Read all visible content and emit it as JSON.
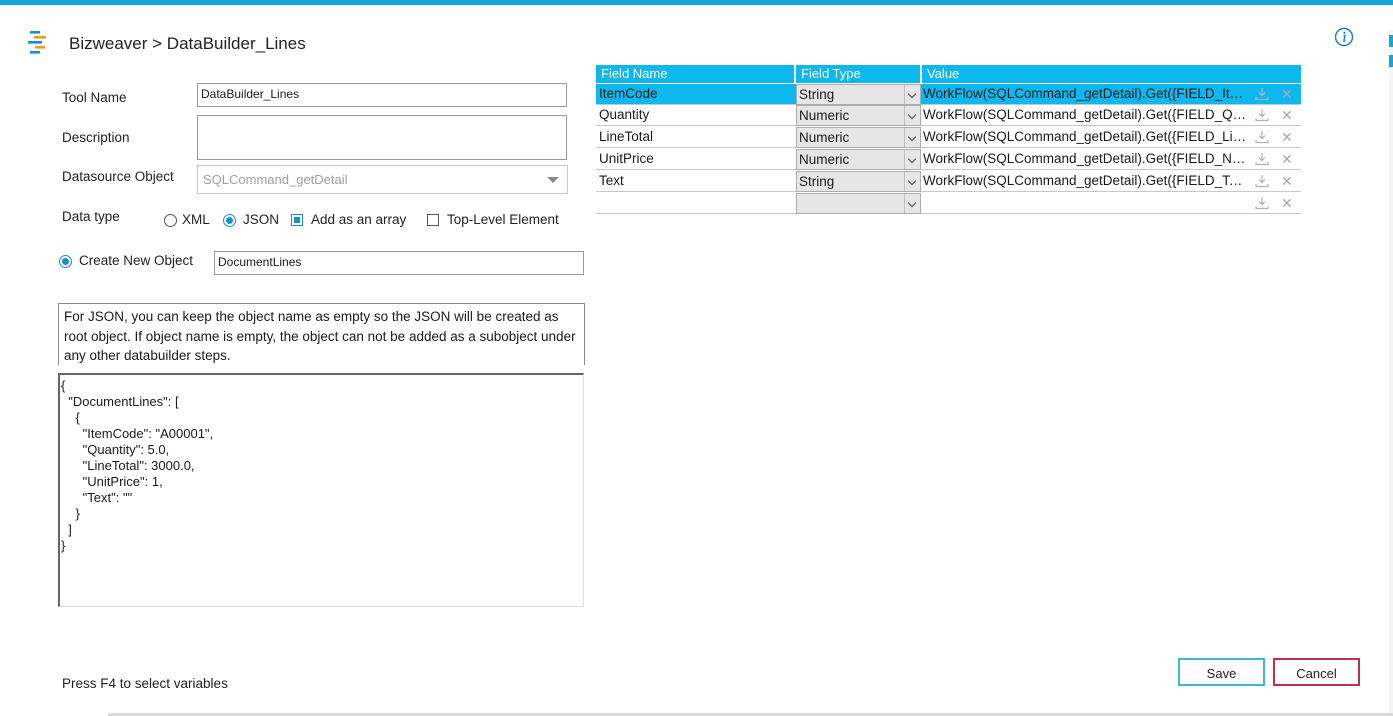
{
  "window": {
    "title": "Bizweaver > DataBuilder_Lines"
  },
  "form": {
    "tool_name_label": "Tool Name",
    "tool_name_value": "DataBuilder_Lines",
    "description_label": "Description",
    "description_value": "",
    "datasource_label": "Datasource Object",
    "datasource_value": "SQLCommand_getDetail",
    "data_type_label": "Data type",
    "xml_label": "XML",
    "json_label": "JSON",
    "data_type_selected": "JSON",
    "add_as_array_label": "Add as an array",
    "add_as_array_checked": true,
    "top_level_label": "Top-Level Element",
    "top_level_checked": false,
    "create_new_object_label": "Create New Object",
    "create_new_object_selected": true,
    "object_name_value": "DocumentLines",
    "note": "For JSON, you can keep the object name as empty so the JSON will be created as root object.  If object name is empty, the object can not be added as a subobject under any other databuilder steps.",
    "json_preview": "{\n  \"DocumentLines\": [\n    {\n      \"ItemCode\": \"A00001\",\n      \"Quantity\": 5.0,\n      \"LineTotal\": 3000.0,\n      \"UnitPrice\": 1,\n      \"Text\": \"\"\n    }\n  ]\n}"
  },
  "grid": {
    "headers": {
      "field_name": "Field Name",
      "field_type": "Field Type",
      "value": "Value"
    },
    "rows": [
      {
        "name": "ItemCode",
        "type": "String",
        "value": "WorkFlow(SQLCommand_getDetail).Get({FIELD_ItemCode})",
        "selected": true
      },
      {
        "name": "Quantity",
        "type": "Numeric",
        "value": "WorkFlow(SQLCommand_getDetail).Get({FIELD_Quantity})",
        "selected": false
      },
      {
        "name": "LineTotal",
        "type": "Numeric",
        "value": "WorkFlow(SQLCommand_getDetail).Get({FIELD_LineTotal})",
        "selected": false
      },
      {
        "name": "UnitPrice",
        "type": "Numeric",
        "value": "WorkFlow(SQLCommand_getDetail).Get({FIELD_NetPrice})",
        "selected": false
      },
      {
        "name": "Text",
        "type": "String",
        "value": "WorkFlow(SQLCommand_getDetail).Get({FIELD_Text})",
        "selected": false
      },
      {
        "name": "",
        "type": "",
        "value": "",
        "selected": false
      }
    ]
  },
  "footer": {
    "hint": "Press F4 to select variables",
    "save_label": "Save",
    "cancel_label": "Cancel"
  },
  "colors": {
    "accent": "#0db8ef",
    "header_bar": "#1aa3d6",
    "radio_blue": "#1a8fd0",
    "cancel_border": "#c0304a"
  },
  "icons": {
    "logo": "bizweaver-logo-icon",
    "info": "info-icon",
    "download": "download-icon",
    "delete": "close-icon"
  }
}
